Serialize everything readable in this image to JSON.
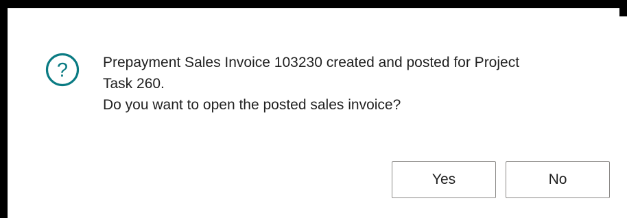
{
  "dialog": {
    "icon": "question-icon",
    "icon_color": "#0a7b83",
    "message_lines": [
      "Prepayment Sales Invoice 103230 created and posted for Project",
      "Task 260.",
      "Do you want to open the posted sales invoice?"
    ],
    "yes_label": "Yes",
    "no_label": "No"
  }
}
